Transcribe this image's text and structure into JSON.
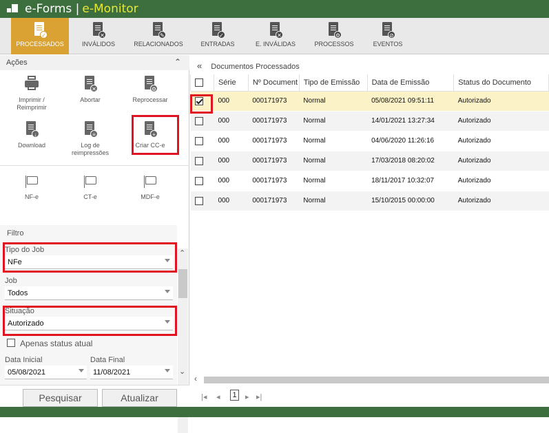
{
  "app": {
    "title_part1": "e-Forms |",
    "title_part2": "e-Monitor"
  },
  "toolbar": [
    {
      "label": "PROCESSADOS",
      "icon": "doc-upload-check-icon",
      "badge": "✓",
      "active": true
    },
    {
      "label": "INVÁLIDOS",
      "icon": "doc-upload-x-icon",
      "badge": "✕"
    },
    {
      "label": "RELACIONADOS",
      "icon": "doc-pencil-icon",
      "badge": "✎"
    },
    {
      "label": "ENTRADAS",
      "icon": "doc-download-check-icon",
      "badge": "✓"
    },
    {
      "label": "E. INVÁLIDAS",
      "icon": "doc-download-x-icon",
      "badge": "✕"
    },
    {
      "label": "PROCESSOS",
      "icon": "doc-gear-icon",
      "badge": "⚙"
    },
    {
      "label": "EVENTOS",
      "icon": "doc-blocked-icon",
      "badge": "⊘"
    }
  ],
  "acoes": {
    "title": "Ações",
    "items": [
      {
        "label": "Imprimir / Reimprimir",
        "icon": "printer-icon"
      },
      {
        "label": "Abortar",
        "icon": "doc-x-icon",
        "badge": "✕"
      },
      {
        "label": "Reprocessar",
        "icon": "doc-gear-icon",
        "badge": "⚙"
      },
      {
        "label": "Download",
        "icon": "doc-download-icon",
        "badge": "↓"
      },
      {
        "label": "Log de reimpressões",
        "icon": "doc-csv-icon",
        "badge": "≡"
      },
      {
        "label": "Criar CC-e",
        "icon": "doc-plus-icon",
        "badge": "+"
      }
    ],
    "flags": [
      {
        "label": "NF-e",
        "icon": "flag-icon"
      },
      {
        "label": "CT-e",
        "icon": "flag-icon"
      },
      {
        "label": "MDF-e",
        "icon": "flag-icon"
      }
    ]
  },
  "filtro": {
    "title": "Filtro",
    "tipo_job_label": "Tipo do Job",
    "tipo_job_value": "NFe",
    "job_label": "Job",
    "job_value": "Todos",
    "situacao_label": "Situação",
    "situacao_value": "Autorizado",
    "apenas_label": "Apenas status atual",
    "data_inicial_label": "Data Inicial",
    "data_inicial_value": "05/08/2021",
    "data_final_label": "Data Final",
    "data_final_value": "11/08/2021"
  },
  "buttons": {
    "pesquisar": "Pesquisar",
    "atualizar": "Atualizar"
  },
  "documents": {
    "title": "Documentos Processados",
    "columns": [
      "Série",
      "Nº Document",
      "Tipo de Emissão",
      "Data de Emissão",
      "Status do Documento"
    ],
    "rows": [
      {
        "serie": "000",
        "numero": "000171973",
        "tipo": "Normal",
        "data": "05/08/2021 09:51:11",
        "status": "Autorizado",
        "checked": true
      },
      {
        "serie": "000",
        "numero": "000171973",
        "tipo": "Normal",
        "data": "14/01/2021 13:27:34",
        "status": "Autorizado"
      },
      {
        "serie": "000",
        "numero": "000171973",
        "tipo": "Normal",
        "data": "04/06/2020 11:26:16",
        "status": "Autorizado"
      },
      {
        "serie": "000",
        "numero": "000171973",
        "tipo": "Normal",
        "data": "17/03/2018 08:20:02",
        "status": "Autorizado"
      },
      {
        "serie": "000",
        "numero": "000171973",
        "tipo": "Normal",
        "data": "18/11/2017 10:32:07",
        "status": "Autorizado"
      },
      {
        "serie": "000",
        "numero": "000171973",
        "tipo": "Normal",
        "data": "15/10/2015 00:00:00",
        "status": "Autorizado"
      }
    ]
  },
  "pager": {
    "page": "1"
  },
  "colors": {
    "brand_green": "#3c6e3e",
    "active_orange": "#d9a233",
    "highlight_red": "#e0141e",
    "selected_row": "#fbf2c7"
  }
}
